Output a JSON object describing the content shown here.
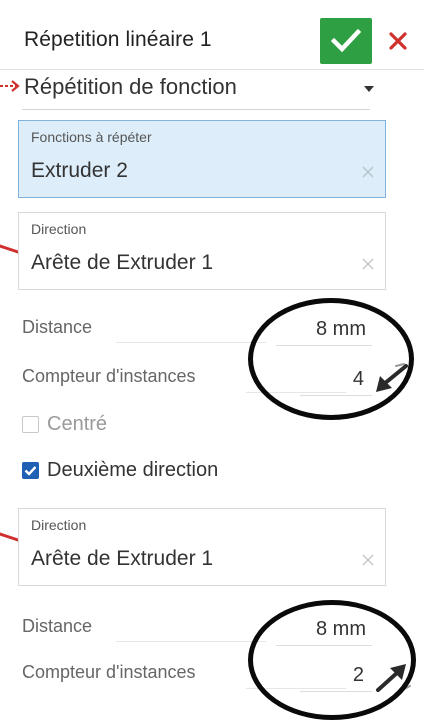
{
  "header": {
    "title": "Répetition linéaire 1"
  },
  "pattern_type": {
    "selected": "Répétition de fonction"
  },
  "features": {
    "label": "Fonctions à répéter",
    "value": "Extruder 2"
  },
  "direction1": {
    "label": "Direction",
    "value": "Arête de Extruder 1",
    "distance_label": "Distance",
    "distance_value": "8 mm",
    "count_label": "Compteur d'instances",
    "count_value": "4"
  },
  "centered": {
    "label": "Centré",
    "checked": false
  },
  "second_direction": {
    "label": "Deuxième direction",
    "checked": true
  },
  "direction2": {
    "label": "Direction",
    "value": "Arête de Extruder 1",
    "distance_label": "Distance",
    "distance_value": "8 mm",
    "count_label": "Compteur d'instances",
    "count_value": "2"
  },
  "colors": {
    "accept": "#2ea043",
    "cancel": "#d0312d",
    "active_field": "#ddeefa",
    "checkbox_checked": "#1f5fb4",
    "annotation": "#0a0a0a"
  }
}
